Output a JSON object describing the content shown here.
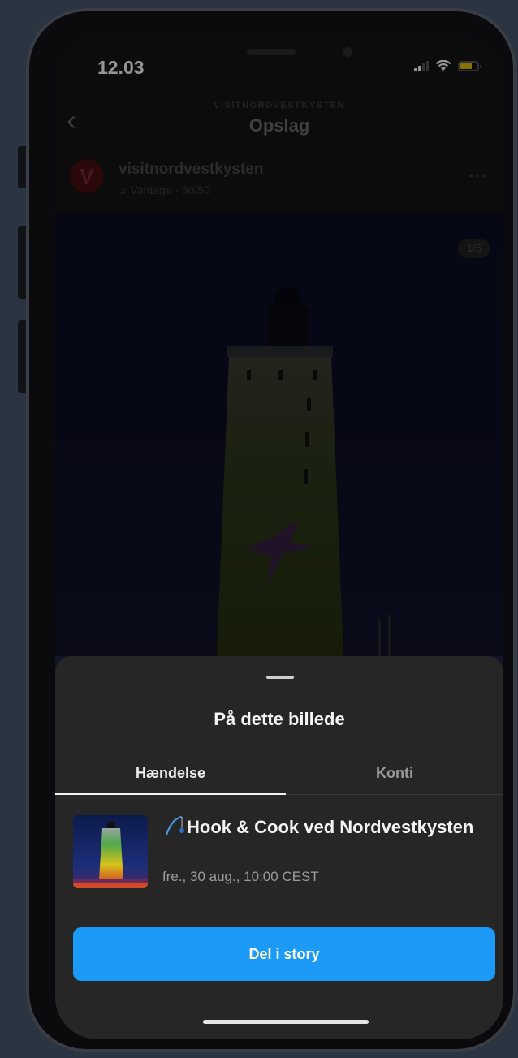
{
  "status_bar": {
    "time": "12.03"
  },
  "header": {
    "account_caption": "VISITNORDVESTKYSTEN",
    "title": "Opslag"
  },
  "post": {
    "avatar_letter": "V",
    "username": "visitnordvestkysten",
    "audio_label": "♫ Vantage · 50/50",
    "image_counter": "1/5"
  },
  "sheet": {
    "title": "På dette billede",
    "tabs": [
      {
        "label": "Hændelse",
        "active": true
      },
      {
        "label": "Konti",
        "active": false
      }
    ],
    "event": {
      "title": "Hook & Cook ved Nordvestkysten",
      "date": "fre., 30 aug., 10:00 CEST"
    },
    "share_button_label": "Del i story"
  },
  "colors": {
    "accent": "#1b9af7",
    "sheet_background": "#262626",
    "page_background": "#2b3542",
    "lighthouse_glow": "#7c9a2f"
  }
}
